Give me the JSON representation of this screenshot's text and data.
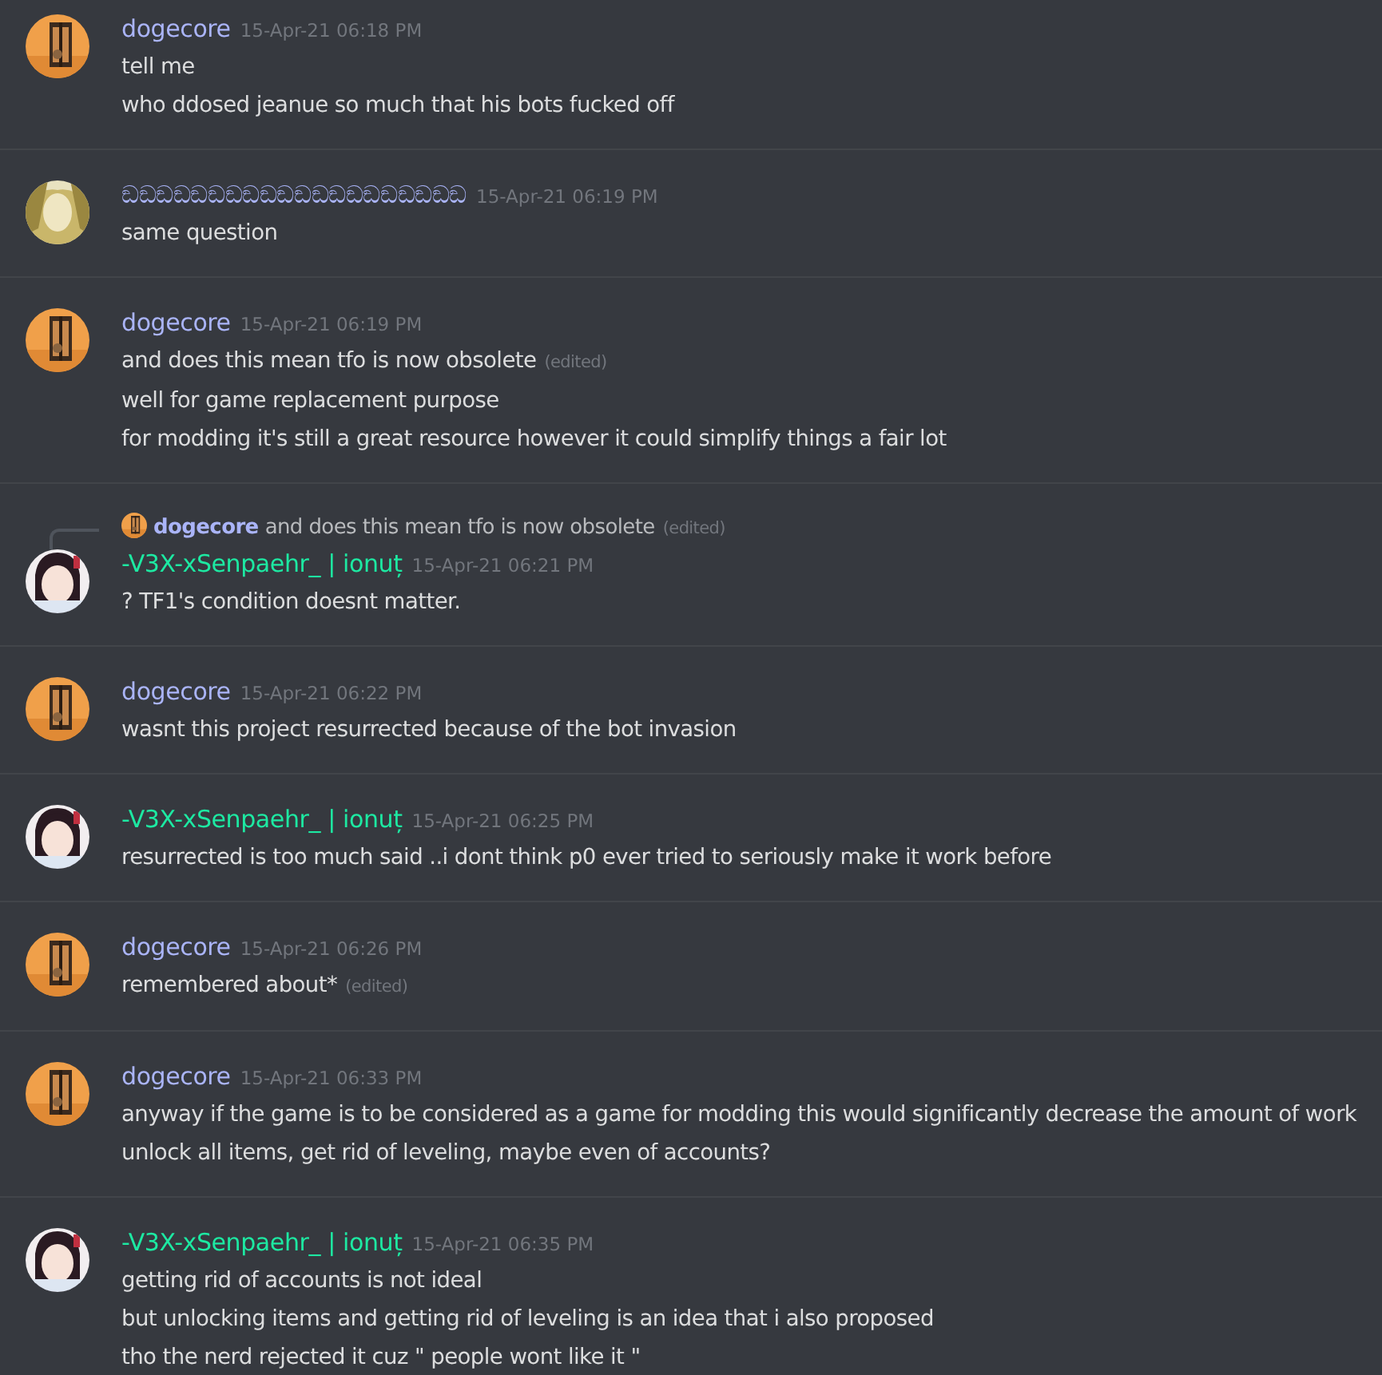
{
  "messages": [
    {
      "author": "dogecore",
      "color": "#aab4f8",
      "avatar": {
        "kind": "window"
      },
      "time": "15-Apr-21 06:18 PM",
      "lines": [
        {
          "text": "tell me"
        },
        {
          "text": "who ddosed jeanue so much that his bots fucked off"
        }
      ]
    },
    {
      "author": "ඞඞඞඞඞඞඞඞඞඞඞඞඞඞඞඞඞඞඞඞ",
      "color": "#aab4f8",
      "avatar": {
        "kind": "gold"
      },
      "time": "15-Apr-21 06:19 PM",
      "lines": [
        {
          "text": "same question"
        }
      ]
    },
    {
      "author": "dogecore",
      "color": "#aab4f8",
      "avatar": {
        "kind": "window"
      },
      "time": "15-Apr-21 06:19 PM",
      "lines": [
        {
          "text": "and does this mean tfo is now obsolete",
          "edited_tag": "(edited)"
        },
        {
          "text": "well for game replacement purpose"
        },
        {
          "text": "for modding it's still a great resource however it could simplify things a fair lot"
        }
      ]
    },
    {
      "author": "-V3X-xSenpaehr_ | ionuț",
      "color": "#1de9a2",
      "avatar": {
        "kind": "figure"
      },
      "time": "15-Apr-21 06:21 PM",
      "reply": {
        "author": "dogecore",
        "text": "and does this mean tfo is now obsolete",
        "edited_tag": "(edited)"
      },
      "lines": [
        {
          "text": "? TF1's condition doesnt matter."
        }
      ]
    },
    {
      "author": "dogecore",
      "color": "#aab4f8",
      "avatar": {
        "kind": "window"
      },
      "time": "15-Apr-21 06:22 PM",
      "lines": [
        {
          "text": "wasnt this project resurrected because of the bot invasion"
        }
      ]
    },
    {
      "author": "-V3X-xSenpaehr_ | ionuț",
      "color": "#1de9a2",
      "avatar": {
        "kind": "figure"
      },
      "time": "15-Apr-21 06:25 PM",
      "lines": [
        {
          "text": "resurrected is too much said ..i dont think p0 ever tried to seriously make it work before"
        }
      ]
    },
    {
      "author": "dogecore",
      "color": "#aab4f8",
      "avatar": {
        "kind": "window"
      },
      "time": "15-Apr-21 06:26 PM",
      "lines": [
        {
          "text": "remembered about*",
          "edited_tag": "(edited)"
        }
      ]
    },
    {
      "author": "dogecore",
      "color": "#aab4f8",
      "avatar": {
        "kind": "window"
      },
      "time": "15-Apr-21 06:33 PM",
      "lines": [
        {
          "text": "anyway if the game is to be considered as a game for modding this would significantly decrease the amount of work"
        },
        {
          "text": "unlock all items, get rid of leveling, maybe even of accounts?"
        }
      ]
    },
    {
      "author": "-V3X-xSenpaehr_ | ionuț",
      "color": "#1de9a2",
      "avatar": {
        "kind": "figure"
      },
      "time": "15-Apr-21 06:35 PM",
      "lines": [
        {
          "text": "getting rid of accounts is not ideal"
        },
        {
          "text": "but unlocking items and getting rid of leveling is an idea that i also proposed"
        },
        {
          "text": "tho the nerd rejected it cuz \" people wont like it \""
        }
      ]
    }
  ]
}
